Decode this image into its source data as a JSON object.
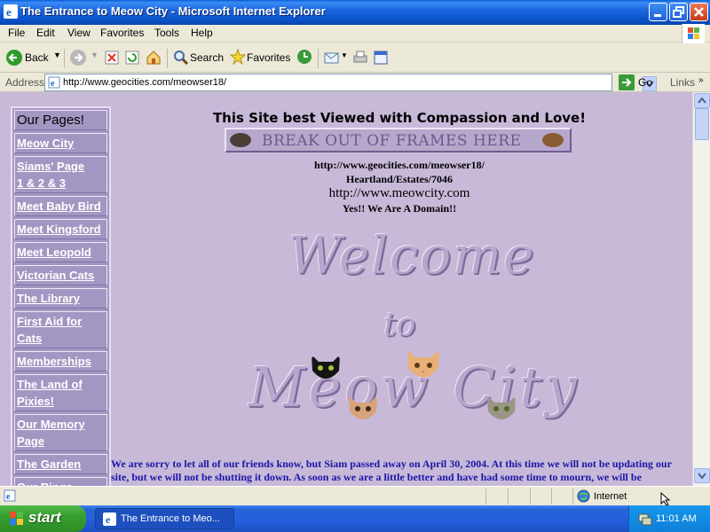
{
  "window": {
    "title": "The Entrance to Meow City - Microsoft Internet Explorer"
  },
  "menu": {
    "items": [
      "File",
      "Edit",
      "View",
      "Favorites",
      "Tools",
      "Help"
    ]
  },
  "toolbar": {
    "back": "Back",
    "search": "Search",
    "favorites": "Favorites"
  },
  "address": {
    "label": "Address",
    "url": "http://www.geocities.com/meowser18/",
    "go": "Go",
    "links": "Links"
  },
  "sidebar": {
    "title": "Our Pages!",
    "items": [
      "Meow City",
      "Siams' Page",
      "1",
      "&",
      "2",
      "&",
      "3",
      "Meet Baby Bird",
      "Meet Kingsford",
      "Meet Leopold",
      "Victorian Cats",
      "The Library",
      "First Aid for Cats",
      "Memberships",
      "The Land of Pixies!",
      "Our Memory Page",
      "The Garden",
      "Our Rings"
    ]
  },
  "main": {
    "best_viewed": "This Site best Viewed with Compassion and Love!",
    "break_frames": "BREAK OUT OF FRAMES HERE",
    "url1": "http://www.geocities.com/meowser18/",
    "url2": "Heartland/Estates/7046",
    "url3": "http://www.meowcity.com",
    "domain": "Yes!! We Are A Domain!!",
    "welcome": "Welcome",
    "to": "to",
    "meow_city": "Meow City",
    "notice": "We are sorry to let all of our friends know, but Siam passed away on April 30, 2004. At this time we will not be updating our site, but we will not be shutting it down. As soon as we are a little better and have had some time to mourn, we will be"
  },
  "status": {
    "zone": "Internet"
  },
  "taskbar": {
    "start": "start",
    "task": "The Entrance to Meo...",
    "clock": "11:01 AM"
  },
  "colors": {
    "page_bg": "#c8b9d8",
    "sidebar_bg": "#a496c2",
    "notice_text": "#1a17a8",
    "title_bar": "#0a52c8"
  }
}
